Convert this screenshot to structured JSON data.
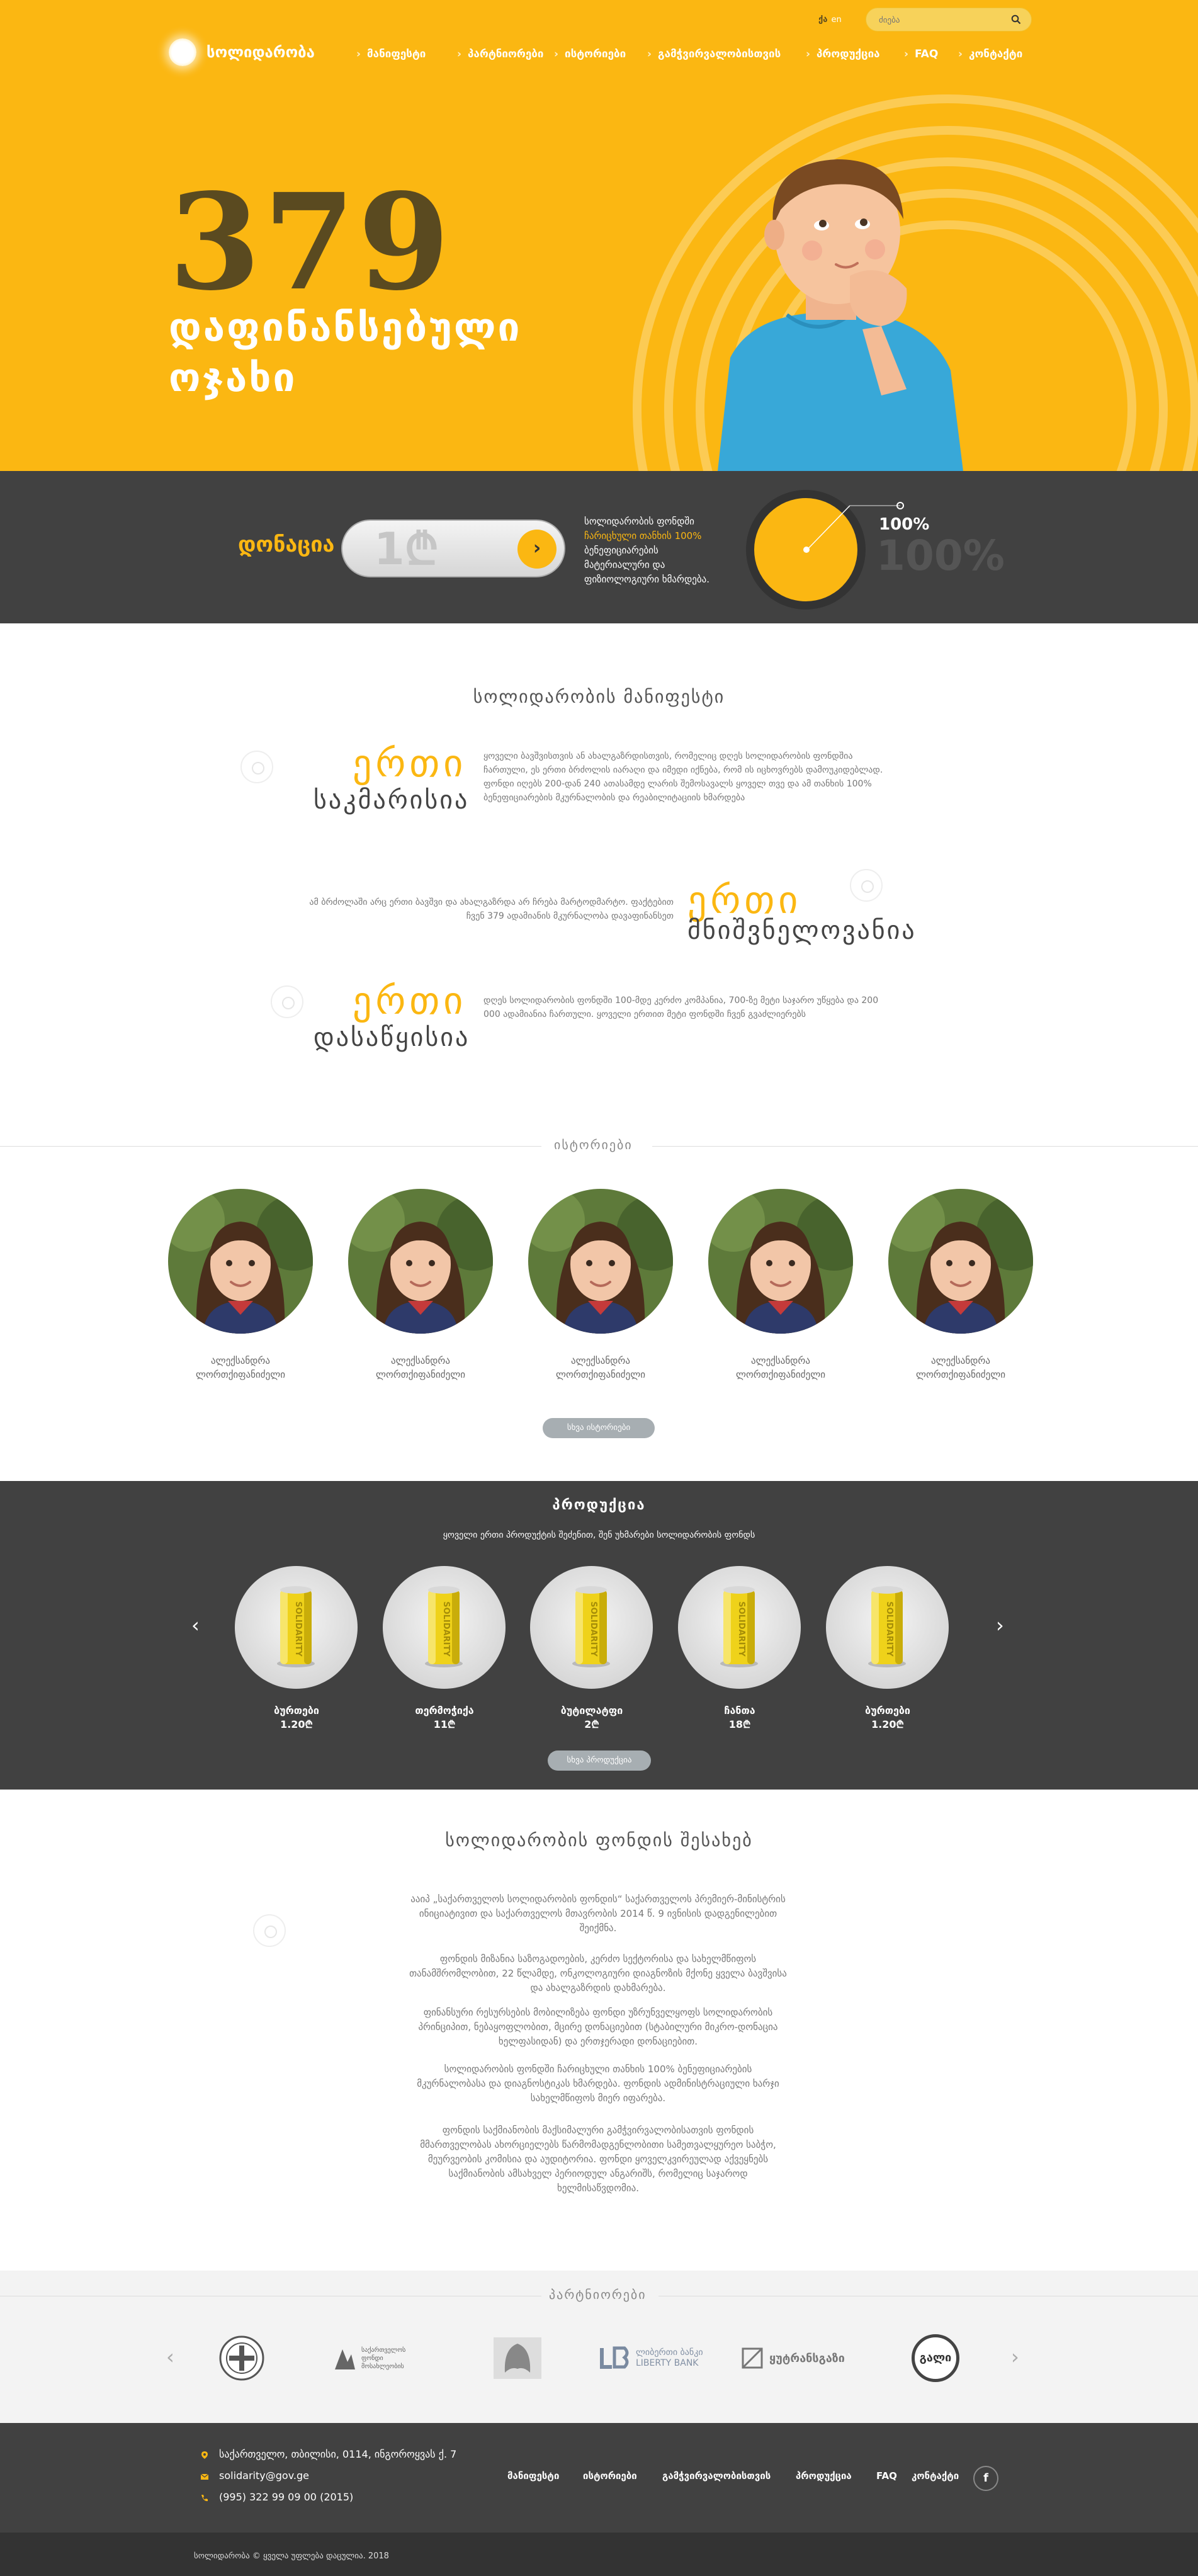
{
  "header": {
    "logo_text": "სოლიდარობა",
    "lang": {
      "current": "ქა",
      "alt": "en"
    },
    "search": {
      "placeholder": "ძიება"
    },
    "nav": [
      "მანიფესტი",
      "პარტნიორები",
      "ისტორიები",
      "გამჭვირვალობისთვის",
      "პროდუქცია",
      "FAQ",
      "კონტაქტი"
    ]
  },
  "hero": {
    "number": "379",
    "caption_line1": "დაფინანსებული",
    "caption_line2": "ოჯახი"
  },
  "donate": {
    "label": "დონაცია",
    "amount": "1₾",
    "go": "›",
    "text_line1": "სოლიდარობის ფონდში",
    "text_hl": "ჩარიცხული თანხის 100%",
    "text_rest": "ბენეფიციარების მატერიალური და ფიზიოლოგიური ხმარდება.",
    "gauge_percent": "100%",
    "gauge_ghost": "100%",
    "gauge_value": 1.0
  },
  "manifest": {
    "title": "სოლიდარობის მანიფესტი",
    "items": [
      {
        "word": "ერთი",
        "sub": "საკმარისია",
        "text": "ყოველი ბავშვისთვის ან ახალგაზრდისთვის, რომელიც დღეს სოლიდარობის ფონდშია ჩართული, ეს ერთი ბრძოლის იარაღი და იმედი იქნება, რომ ის იცხოვრებს დამოუკიდებლად. ფონდი იღებს 200-დან 240 ათასამდე ლარის შემოსავალს ყოველ თვე და ამ თანხის 100% ბენეფიციარების მკურნალობის და რეაბილიტაციის ხმარდება"
      },
      {
        "word": "ერთი",
        "sub": "მნიშვნელოვანია",
        "text": "ამ ბრძოლაში არც ერთი ბავშვი და ახალგაზრდა არ ჩრება მარტოდმარტო. ფაქტებით ჩვენ 379 ადამიანის მკურნალობა დავაფინანსეთ"
      },
      {
        "word": "ერთი",
        "sub": "დასაწყისია",
        "text": "დღეს სოლიდარობის ფონდში 100-მდე კერძო კომპანია, 700-ზე მეტი საჯარო უწყება და 200 000 ადამიანია ჩართული. ყოველი ერთით მეტი ფონდში ჩვენ გვაძლიერებს"
      }
    ]
  },
  "stories": {
    "title": "ისტორიები",
    "items": [
      {
        "name_line1": "ალექსანდრა",
        "name_line2": "ლორთქიფანიძელი"
      },
      {
        "name_line1": "ალექსანდრა",
        "name_line2": "ლორთქიფანიძელი"
      },
      {
        "name_line1": "ალექსანდრა",
        "name_line2": "ლორთქიფანიძელი"
      },
      {
        "name_line1": "ალექსანდრა",
        "name_line2": "ლორთქიფანიძელი"
      },
      {
        "name_line1": "ალექსანდრა",
        "name_line2": "ლორთქიფანიძელი"
      }
    ],
    "more_button": "სხვა ისტორიები"
  },
  "products": {
    "title": "პროდუქცია",
    "subtitle": "ყოველი ერთი პროდუქტის შეძენით, შენ უხმარები სოლიდარობის ფონდს",
    "items": [
      {
        "name": "ბურთები",
        "price": "1.20₾"
      },
      {
        "name": "თერმოჭიქა",
        "price": "11₾"
      },
      {
        "name": "ბუტილატფი",
        "price": "2₾"
      },
      {
        "name": "ჩანთა",
        "price": "18₾"
      },
      {
        "name": "ბურთები",
        "price": "1.20₾"
      }
    ],
    "can_label": "SOLIDARITY",
    "more_button": "სხვა პროდუქცია",
    "prev": "‹",
    "next": "›"
  },
  "about": {
    "title": "სოლიდარობის ფონდის შესახებ",
    "paragraphs": [
      "ააიპ „საქართველოს სოლიდარობის ფონდის“ საქართველოს პრემიერ-მინისტრის ინიციატივით და საქართველოს მთავრობის 2014 წ. 9 ივნისის დადგენილებით შეიქმნა.",
      "ფონდის მიზანია საზოგადოების, კერძო სექტორისა და სახელმწიფოს თანამშრომლობით, 22 წლამდე, ონკოლოგიური დიაგნოზის მქონე ყველა ბავშვისა და ახალგაზრდის დახმარება.",
      "ფინანსური რესურსების მობილიზება ფონდი უზრუნველყოფს სოლიდარობის პრინციპით, ნებაყოფლობით, მცირე დონაციებით (სტაბილური მიკრო-დონაცია ხელფასიდან) და ერთჯერადი დონაციებით.",
      "სოლიდარობის ფონდში ჩარიცხული თანხის 100% ბენეფიციარების მკურნალობასა და დიაგნოსტიკას ხმარდება. ფონდის ადმინისტრაციული ხარჯი სახელმწიფოს მიერ იფარება.",
      "ფონდის საქმიანობის მაქსიმალური გამჭვირვალობისათვის ფონდის მმართველობას ახორციელებს წარმომადგენლობითი სამეთვალყურეო საბჭო, მეურვეობის კომისია და აუდიტორია. ფონდი ყოველკვირეულად აქვეყნებს საქმიანობის ამსახველ პერიოდულ ანგარიშს, რომელიც საჯაროდ ხელმისაწვდომია."
    ]
  },
  "partners": {
    "title": "პარტნიორები",
    "logos": [
      {
        "text": ""
      },
      {
        "text": "საქართველოს ფონდი მოსახლეობის"
      },
      {
        "text": ""
      },
      {
        "text": "ლიბერთი ბანკი LIBERTY BANK"
      },
      {
        "text": "ყუტრანსგაზი"
      },
      {
        "text": "გალი"
      }
    ]
  },
  "footer": {
    "address": "საქართველო, თბილისი, 0114, ინგოროყვას ქ. 7",
    "email": "solidarity@gov.ge",
    "phone": "(995) 322 99 09 00 (2015)",
    "nav": [
      "მანიფესტი",
      "ისტორიები",
      "გამჭვირვალობისთვის",
      "პროდუქცია",
      "FAQ",
      "კონტაქტი"
    ],
    "social": "f",
    "copyright": "სოლიდარობა © ყველა უფლება დაცულია. 2018"
  },
  "colors": {
    "accent": "#fbb712",
    "dark": "#414141",
    "text": "#777777"
  }
}
